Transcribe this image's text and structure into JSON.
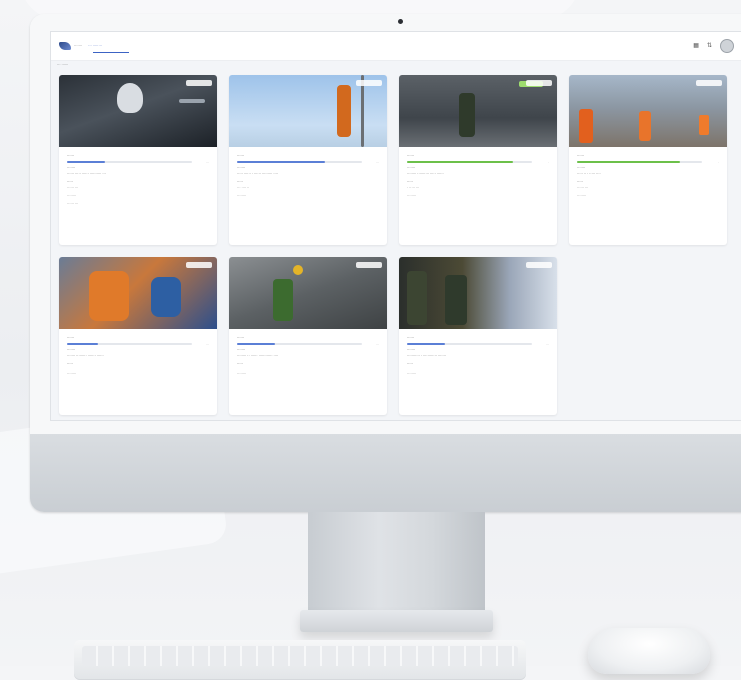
{
  "header": {
    "logo_text": "·······",
    "nav_item": "··· ········",
    "icons": [
      "grid-icon",
      "notification-icon",
      "avatar"
    ]
  },
  "breadcrumb": "··· ······",
  "cards": [
    {
      "scene": "dark",
      "badge": "",
      "lbl1": "······",
      "progress": 0.3,
      "progress_color": "#5b7fd6",
      "prog_val": "···",
      "lbl2": "·······",
      "desc": "······ ····· ······ ·········· ···",
      "lbl3": "·····",
      "meta1": "······ ···",
      "meta2": "········",
      "meta3": "······ ···"
    },
    {
      "scene": "sky",
      "badge": "",
      "lbl1": "······",
      "progress": 0.7,
      "progress_color": "#5b7fd6",
      "prog_val": "···",
      "lbl2": "·······",
      "desc": "····· ······ · ······ ········· ····",
      "lbl3": "·····",
      "meta1": "··· ···· ··",
      "meta2": "········",
      "meta3": ""
    },
    {
      "scene": "road",
      "badge": "",
      "lbl1": "······",
      "progress": 0.85,
      "progress_color": "#6cc04a",
      "prog_val": "·",
      "lbl2": "·······",
      "desc": "········ ·········· ····· ······",
      "lbl3": "·····",
      "meta1": "· ····· ···",
      "meta2": "········",
      "meta3": ""
    },
    {
      "scene": "city",
      "badge": "",
      "lbl1": "······",
      "progress": 0.82,
      "progress_color": "#6cc04a",
      "prog_val": "·",
      "lbl2": "·······",
      "desc": "····· ·· · ····· ····",
      "lbl3": "·····",
      "meta1": "······ ···",
      "meta2": "········",
      "meta3": ""
    },
    {
      "scene": "rescue",
      "badge": "",
      "lbl1": "······",
      "progress": 0.25,
      "progress_color": "#5b7fd6",
      "prog_val": "···",
      "lbl2": "·······",
      "desc": "······· ········· ······· ······",
      "lbl3": "·····",
      "meta1": "",
      "meta2": "········",
      "meta3": ""
    },
    {
      "scene": "ground",
      "badge": "",
      "lbl1": "······",
      "progress": 0.3,
      "progress_color": "#5b7fd6",
      "prog_val": "···",
      "lbl2": "·······",
      "desc": "········ ·· ······ ············ ····",
      "lbl3": "·····",
      "meta1": "",
      "meta2": "········",
      "meta3": ""
    },
    {
      "scene": "fire",
      "badge": "",
      "lbl1": "······",
      "progress": 0.3,
      "progress_color": "#5b7fd6",
      "prog_val": "···",
      "lbl2": "·······",
      "desc": "··········· · ············ ·······",
      "lbl3": "·····",
      "meta1": "",
      "meta2": "········",
      "meta3": ""
    }
  ]
}
